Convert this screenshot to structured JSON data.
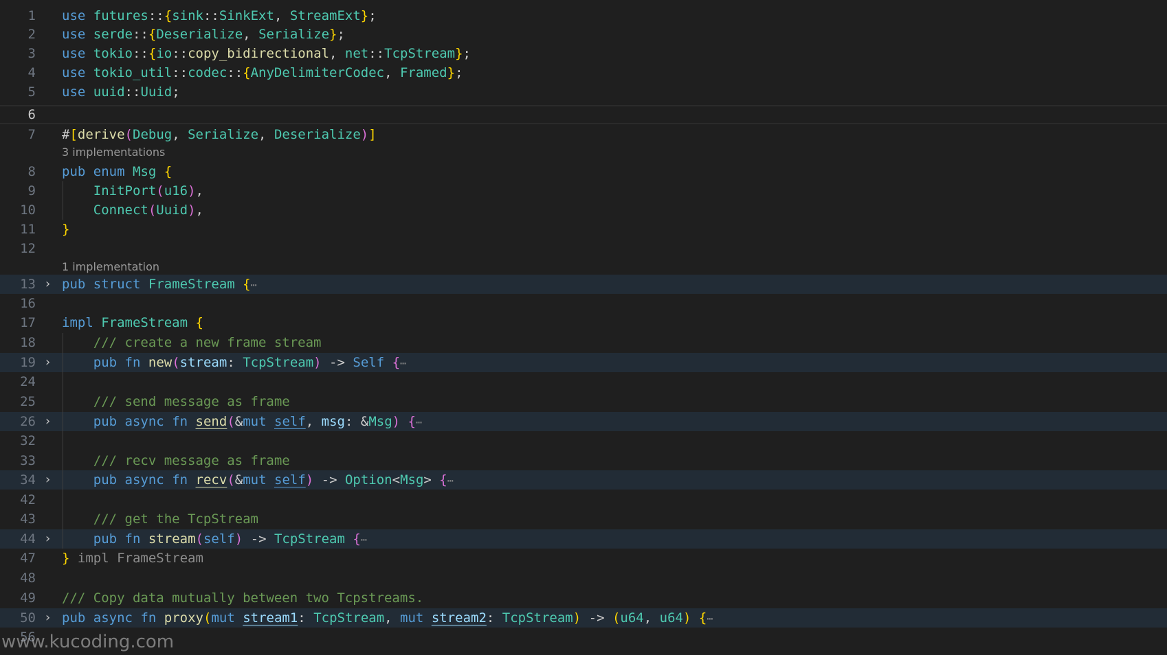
{
  "editor": {
    "code_lens": {
      "msg": "3 implementations",
      "framestream": "1 implementation"
    },
    "inline_hint": "impl FrameStream",
    "fold_ellipsis": "⋯"
  },
  "line_numbers": [
    "1",
    "2",
    "3",
    "4",
    "5",
    "6",
    "7",
    "8",
    "9",
    "10",
    "11",
    "12",
    "13",
    "16",
    "17",
    "18",
    "19",
    "24",
    "25",
    "26",
    "32",
    "33",
    "34",
    "42",
    "43",
    "44",
    "47",
    "48",
    "49",
    "50",
    "56"
  ],
  "tokens": {
    "use": "use",
    "pub": "pub",
    "enum": "enum",
    "struct": "struct",
    "impl": "impl",
    "fn": "fn",
    "async": "async",
    "mut": "mut",
    "self_kw": "self",
    "Self_kw": "Self",
    "futures": "futures",
    "sink": "sink",
    "SinkExt": "SinkExt",
    "StreamExt": "StreamExt",
    "serde": "serde",
    "Deserialize": "Deserialize",
    "Serialize": "Serialize",
    "tokio": "tokio",
    "io": "io",
    "copy_bidirectional": "copy_bidirectional",
    "net": "net",
    "TcpStream": "TcpStream",
    "tokio_util": "tokio_util",
    "codec": "codec",
    "AnyDelimiterCodec": "AnyDelimiterCodec",
    "Framed": "Framed",
    "uuid": "uuid",
    "Uuid": "Uuid",
    "derive": "derive",
    "Debug": "Debug",
    "Msg": "Msg",
    "InitPort": "InitPort",
    "u16": "u16",
    "Connect": "Connect",
    "FrameStream": "FrameStream",
    "new": "new",
    "stream": "stream",
    "send": "send",
    "msg": "msg",
    "recv": "recv",
    "Option": "Option",
    "proxy": "proxy",
    "stream1": "stream1",
    "stream2": "stream2",
    "u64": "u64",
    "c_new": "/// create a new frame stream",
    "c_send": "/// send message as frame",
    "c_recv": "/// recv message as frame",
    "c_get": "/// get the TcpStream",
    "c_copy": "/// Copy data mutually between two Tcpstreams."
  },
  "watermark": "www.kucoding.com"
}
